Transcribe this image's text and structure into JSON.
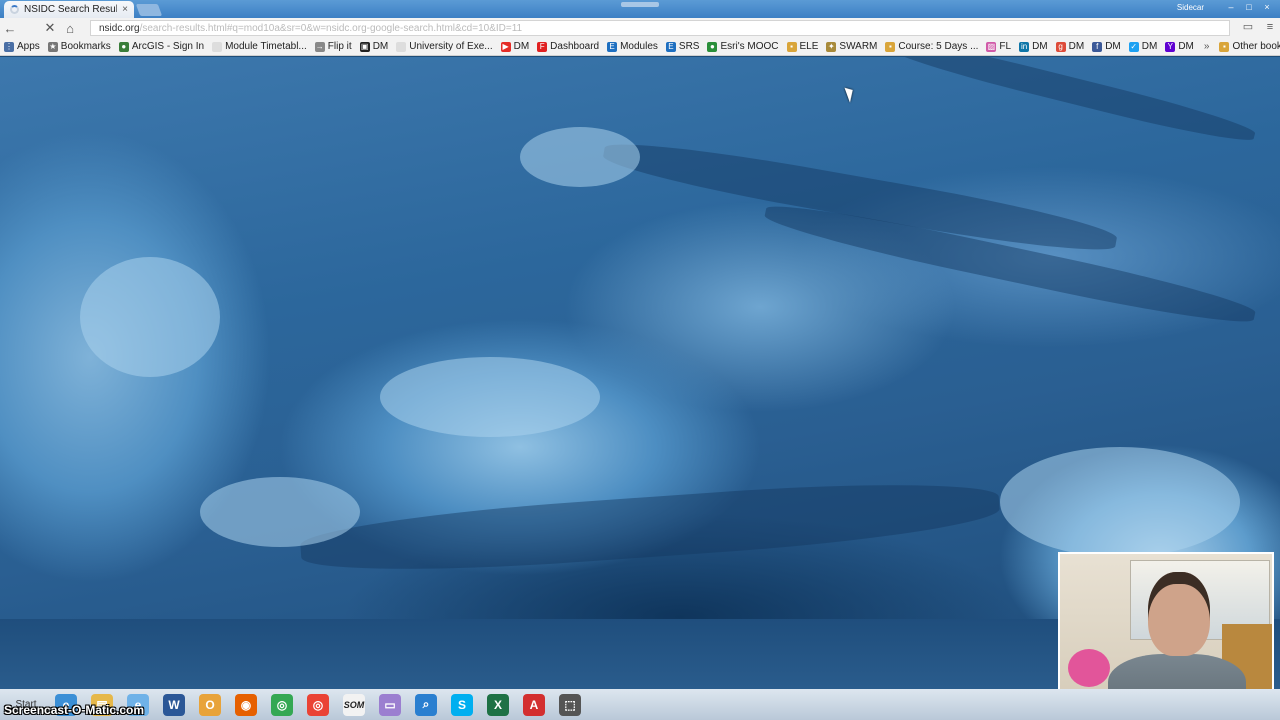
{
  "browser": {
    "tab_title": "NSIDC Search Results",
    "tab_close": "×",
    "url_host": "nsidc.org",
    "url_path": "/search-results.html#q=mod10a&sr=0&w=nsidc.org-google-search.html&cd=10&ID=11",
    "window_user": "Sidecar",
    "controls": {
      "minimize": "–",
      "maximize": "□",
      "close": "×"
    }
  },
  "toolbar": {
    "back": "←",
    "stop": "✕",
    "home": "⌂",
    "cast": "▭",
    "menu": "≡"
  },
  "bookmarks": {
    "items": [
      {
        "label": "Apps",
        "icon": "apps-grid-icon",
        "color": "#4a6fa5",
        "glyph": "⋮"
      },
      {
        "label": "Bookmarks",
        "icon": "star-icon",
        "color": "#777777",
        "glyph": "★"
      },
      {
        "label": "ArcGIS - Sign In",
        "icon": "globe-icon",
        "color": "#3a7d3a",
        "glyph": "●"
      },
      {
        "label": "Module Timetabl...",
        "icon": "page-icon",
        "color": "#dddddd",
        "glyph": ""
      },
      {
        "label": "Flip it",
        "icon": "arrow-icon",
        "color": "#888888",
        "glyph": "→"
      },
      {
        "label": "DM",
        "icon": "cinema-icon",
        "color": "#222222",
        "glyph": "▣"
      },
      {
        "label": "University of Exe...",
        "icon": "page-icon",
        "color": "#dddddd",
        "glyph": ""
      },
      {
        "label": "DM",
        "icon": "youtube-icon",
        "color": "#e52d27",
        "glyph": "▶"
      },
      {
        "label": "Dashboard",
        "icon": "flipboard-icon",
        "color": "#e02020",
        "glyph": "F"
      },
      {
        "label": "Modules",
        "icon": "e-icon",
        "color": "#1e6fc0",
        "glyph": "E"
      },
      {
        "label": "SRS",
        "icon": "e-icon",
        "color": "#1e6fc0",
        "glyph": "E"
      },
      {
        "label": "Esri's MOOC",
        "icon": "esri-icon",
        "color": "#2a8f3a",
        "glyph": "●"
      },
      {
        "label": "ELE",
        "icon": "folder-icon",
        "color": "#d9a53a",
        "glyph": "▪"
      },
      {
        "label": "SWARM",
        "icon": "swarm-icon",
        "color": "#a88a3a",
        "glyph": "✦"
      },
      {
        "label": "Course: 5 Days ...",
        "icon": "folder-icon",
        "color": "#d9a53a",
        "glyph": "▪"
      },
      {
        "label": "FL",
        "icon": "image-icon",
        "color": "#d05aa8",
        "glyph": "▨"
      },
      {
        "label": "DM",
        "icon": "linkedin-icon",
        "color": "#0e76a8",
        "glyph": "in"
      },
      {
        "label": "DM",
        "icon": "google-plus-icon",
        "color": "#dd4b39",
        "glyph": "g"
      },
      {
        "label": "DM",
        "icon": "facebook-icon",
        "color": "#3b5998",
        "glyph": "f"
      },
      {
        "label": "DM",
        "icon": "twitter-icon",
        "color": "#1da1f2",
        "glyph": "✓"
      },
      {
        "label": "DM",
        "icon": "yahoo-icon",
        "color": "#5f01d1",
        "glyph": "Y"
      }
    ],
    "more": "»",
    "other": {
      "label": "Other bookmarks",
      "icon": "folder-icon",
      "color": "#d9a53a",
      "glyph": "▪"
    }
  },
  "taskbar": {
    "start_label": "Start",
    "apps": [
      {
        "name": "ie-app",
        "icon": "internet-explorer-icon",
        "color": "#3b8fd6",
        "glyph": "e"
      },
      {
        "name": "explorer-app",
        "icon": "folder-icon",
        "color": "#e6b84a",
        "glyph": "▤"
      },
      {
        "name": "ie-app-2",
        "icon": "internet-explorer-icon",
        "color": "#6fb2e8",
        "glyph": "e"
      },
      {
        "name": "word-app",
        "icon": "word-icon",
        "color": "#2b5797",
        "glyph": "W"
      },
      {
        "name": "outlook-app",
        "icon": "outlook-icon",
        "color": "#e8a33a",
        "glyph": "O"
      },
      {
        "name": "firefox-app",
        "icon": "firefox-icon",
        "color": "#e66000",
        "glyph": "◉"
      },
      {
        "name": "chrome-app",
        "icon": "chrome-icon",
        "color": "#34a853",
        "glyph": "◎"
      },
      {
        "name": "chrome-app-2",
        "icon": "chrome-icon",
        "color": "#ea4335",
        "glyph": "◎"
      },
      {
        "name": "som-app",
        "icon": "som-icon",
        "color": "#f2f2f2",
        "glyph": "SOM"
      },
      {
        "name": "note-app",
        "icon": "note-icon",
        "color": "#9b7fd0",
        "glyph": "▭"
      },
      {
        "name": "search-app",
        "icon": "magnifier-icon",
        "color": "#2a7fd0",
        "glyph": "⌕"
      },
      {
        "name": "skype-app",
        "icon": "skype-icon",
        "color": "#00aff0",
        "glyph": "S"
      },
      {
        "name": "excel-app",
        "icon": "excel-icon",
        "color": "#1e7145",
        "glyph": "X"
      },
      {
        "name": "acrobat-app",
        "icon": "pdf-icon",
        "color": "#d32f2f",
        "glyph": "A"
      },
      {
        "name": "snipping-app",
        "icon": "snipping-icon",
        "color": "#555555",
        "glyph": "⬚"
      }
    ]
  },
  "watermark": "Screencast-O-Matic.com"
}
